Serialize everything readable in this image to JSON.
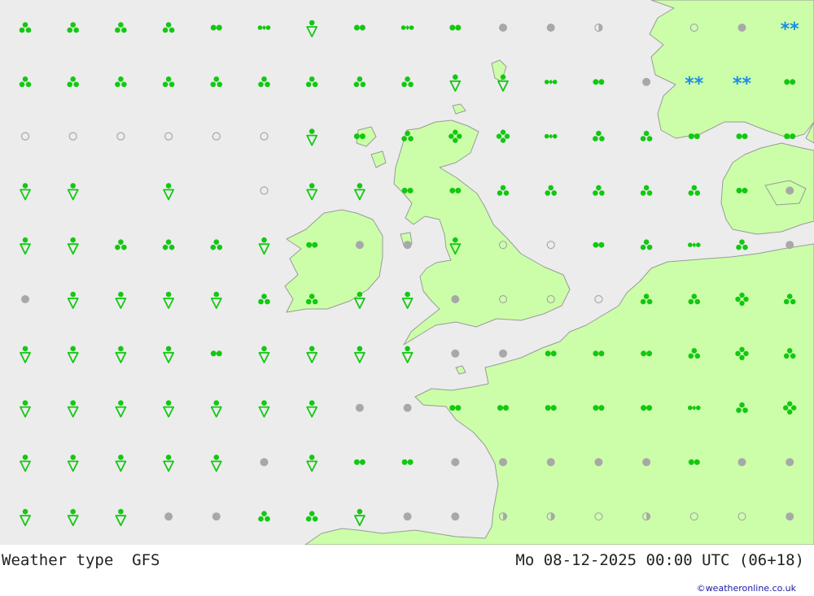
{
  "footer": {
    "title": "Weather type",
    "model": "GFS",
    "datetime": "Mo 08-12-2025 00:00 UTC (06+18)",
    "credit": "©weatheronline.co.uk"
  },
  "colors": {
    "sea": "#ececec",
    "land": "#ccfea9",
    "coast": "#9a9a9a",
    "rain": "#12c812",
    "cloud": "#a8a8a8",
    "snow": "#1a8ce6"
  },
  "legend_symbols": {
    "r1": "rain-drop-single",
    "r2": "rain-drops-double",
    "r3": "rain-drops-triple",
    "rd": "rain-drops-diamond",
    "r4": "rain-drops-heavy",
    "sh": "rain-shower",
    "co": "overcast",
    "cl": "clear",
    "ch": "partly-cloudy",
    "sn": "snow"
  },
  "weather_grid": [
    [
      "r3",
      "r3",
      "r3",
      "r3",
      "r2",
      "rd",
      "sh",
      "r2",
      "rd",
      "r2",
      "co",
      "co",
      "ch",
      "",
      "cl",
      "co",
      "sn"
    ],
    [
      "r3",
      "r3",
      "r3",
      "r3",
      "r3",
      "r3",
      "r3",
      "r3",
      "r3",
      "sh",
      "sh",
      "rd",
      "r2",
      "co",
      "sn",
      "sn",
      "r2"
    ],
    [
      "cl",
      "cl",
      "cl",
      "cl",
      "cl",
      "cl",
      "sh",
      "r2",
      "r3",
      "r4",
      "r4",
      "rd",
      "r3",
      "r3",
      "r2",
      "r2",
      "r2"
    ],
    [
      "sh",
      "sh",
      "",
      "sh",
      "",
      "cl",
      "sh",
      "sh",
      "r2",
      "r2",
      "r3",
      "r3",
      "r3",
      "r3",
      "r3",
      "r2",
      "co"
    ],
    [
      "sh",
      "sh",
      "r3",
      "r3",
      "r3",
      "sh",
      "r2",
      "co",
      "co",
      "sh",
      "cl",
      "cl",
      "r2",
      "r3",
      "rd",
      "r3",
      "co"
    ],
    [
      "co",
      "sh",
      "sh",
      "sh",
      "sh",
      "r3",
      "r3",
      "sh",
      "sh",
      "co",
      "cl",
      "cl",
      "cl",
      "r3",
      "r3",
      "r4",
      "r3"
    ],
    [
      "sh",
      "sh",
      "sh",
      "sh",
      "r2",
      "sh",
      "sh",
      "sh",
      "sh",
      "co",
      "co",
      "r2",
      "r2",
      "r2",
      "r3",
      "r4",
      "r3"
    ],
    [
      "sh",
      "sh",
      "sh",
      "sh",
      "sh",
      "sh",
      "sh",
      "co",
      "co",
      "r2",
      "r2",
      "r2",
      "r2",
      "r2",
      "rd",
      "r3",
      "r4"
    ],
    [
      "sh",
      "sh",
      "sh",
      "sh",
      "sh",
      "co",
      "sh",
      "r2",
      "r2",
      "co",
      "co",
      "co",
      "co",
      "co",
      "r2",
      "co",
      "co"
    ],
    [
      "sh",
      "sh",
      "sh",
      "co",
      "co",
      "r3",
      "r3",
      "sh",
      "co",
      "co",
      "ch",
      "ch",
      "cl",
      "ch",
      "cl",
      "cl",
      "co"
    ]
  ]
}
